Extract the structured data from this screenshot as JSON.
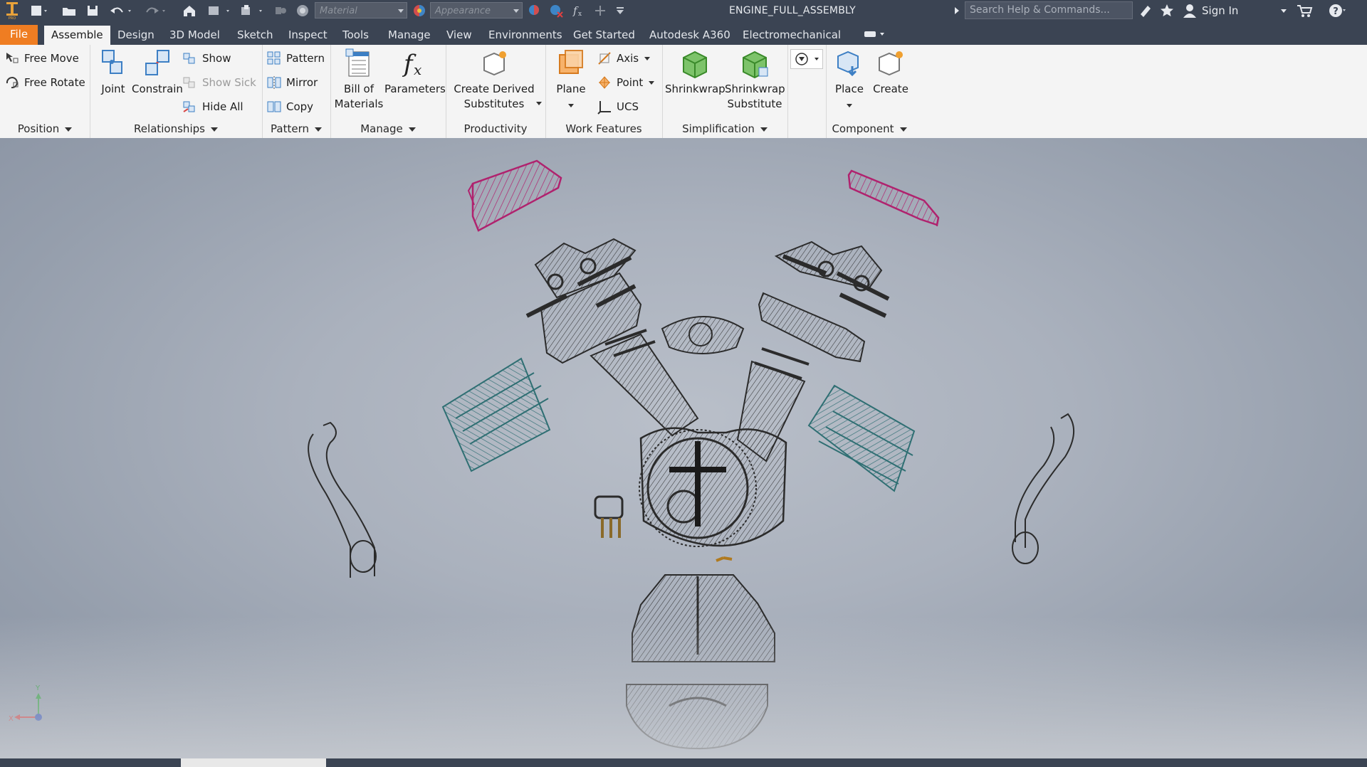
{
  "titlebar": {
    "material_placeholder": "Material",
    "appearance_placeholder": "Appearance",
    "document_title": "ENGINE_FULL_ASSEMBLY",
    "search_placeholder": "Search Help & Commands...",
    "sign_in": "Sign In"
  },
  "tabs": {
    "file": "File",
    "items": [
      "Assemble",
      "Design",
      "3D Model",
      "Sketch",
      "Inspect",
      "Tools",
      "Manage",
      "View",
      "Environments",
      "Get Started",
      "Autodesk A360",
      "Electromechanical"
    ],
    "active": "Assemble"
  },
  "ribbon": {
    "position": {
      "title": "Position",
      "free_move": "Free Move",
      "free_rotate": "Free Rotate"
    },
    "relationships": {
      "title": "Relationships",
      "joint": "Joint",
      "constrain": "Constrain",
      "show": "Show",
      "show_sick": "Show Sick",
      "hide_all": "Hide All"
    },
    "pattern": {
      "title": "Pattern",
      "pattern": "Pattern",
      "mirror": "Mirror",
      "copy": "Copy"
    },
    "manage": {
      "title": "Manage",
      "bom_line1": "Bill of",
      "bom_line2": "Materials",
      "parameters": "Parameters"
    },
    "productivity": {
      "title": "Productivity",
      "cds_line1": "Create Derived",
      "cds_line2": "Substitutes"
    },
    "work_features": {
      "title": "Work Features",
      "plane": "Plane",
      "axis": "Axis",
      "point": "Point",
      "ucs": "UCS"
    },
    "simplification": {
      "title": "Simplification",
      "shrinkwrap": "Shrinkwrap",
      "sws_line1": "Shrinkwrap",
      "sws_line2": "Substitute"
    },
    "component": {
      "title": "Component",
      "place": "Place",
      "create": "Create"
    }
  },
  "colors": {
    "titlebar": "#3b4453",
    "file_tab": "#ef7d22",
    "ribbon": "#f4f4f4",
    "wire_dark": "#2b2b2b",
    "wire_magenta": "#b0226e",
    "wire_teal": "#2f6f73"
  },
  "viewcube": {
    "x_label": "X",
    "y_label": "Y"
  }
}
